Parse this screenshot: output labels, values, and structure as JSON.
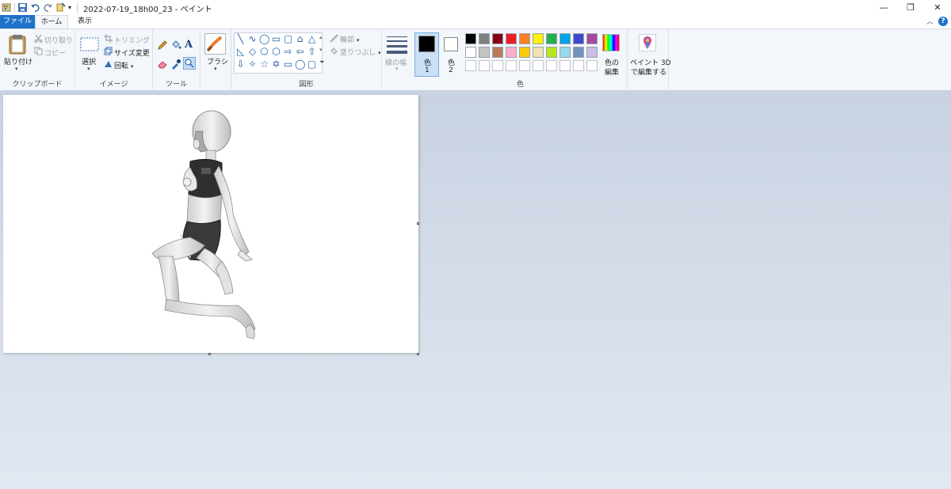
{
  "window": {
    "title": "2022-07-19_18h00_23 - ペイント",
    "buttons": {
      "minimize": "—",
      "restore": "❐",
      "close": "✕"
    }
  },
  "tabs": {
    "file": "ファイル",
    "home": "ホーム",
    "view": "表示"
  },
  "help": "?",
  "ribbon": {
    "clipboard": {
      "paste": "貼り付け",
      "cut": "切り取り",
      "copy": "コピー",
      "label": "クリップボード"
    },
    "image": {
      "select": "選択",
      "crop": "トリミング",
      "resize": "サイズ変更",
      "rotate": "回転",
      "label": "イメージ"
    },
    "tools": {
      "label": "ツール"
    },
    "brush": {
      "label": "ブラシ"
    },
    "shapes": {
      "outline": "輪郭",
      "fill": "塗りつぶし",
      "label": "図形"
    },
    "size": {
      "label": "線の幅"
    },
    "color1": {
      "label": "色",
      "num": "1",
      "value": "#000000"
    },
    "color2": {
      "label": "色",
      "num": "2",
      "value": "#ffffff"
    },
    "edit_colors": {
      "line1": "色の",
      "line2": "編集"
    },
    "colors_label": "色",
    "paint3d": {
      "line1": "ペイント 3D",
      "line2": "で編集する"
    }
  },
  "palette": {
    "row1": [
      "#000000",
      "#7f7f7f",
      "#880015",
      "#ed1c24",
      "#ff7f27",
      "#fff200",
      "#22b14c",
      "#00a2e8",
      "#3f48cc",
      "#a349a4"
    ],
    "row2": [
      "#ffffff",
      "#c3c3c3",
      "#b97a57",
      "#ffaec9",
      "#ffc90e",
      "#efe4b0",
      "#b5e61d",
      "#99d9ea",
      "#7092be",
      "#c8bfe7"
    ],
    "row3": [
      "#ffffff",
      "#ffffff",
      "#ffffff",
      "#ffffff",
      "#ffffff",
      "#ffffff",
      "#ffffff",
      "#ffffff",
      "#ffffff",
      "#ffffff"
    ]
  },
  "shape_icons": [
    "╲",
    "∿",
    "◯",
    "▭",
    "▢",
    "⌂",
    "△",
    "◺",
    "◇",
    "⬠",
    "⬡",
    "⇨",
    "⇦",
    "⇧",
    "⇩",
    "✧",
    "☆",
    "✡",
    "▭",
    "◯",
    "▢"
  ],
  "canvas": {
    "background": "#ffffff"
  }
}
